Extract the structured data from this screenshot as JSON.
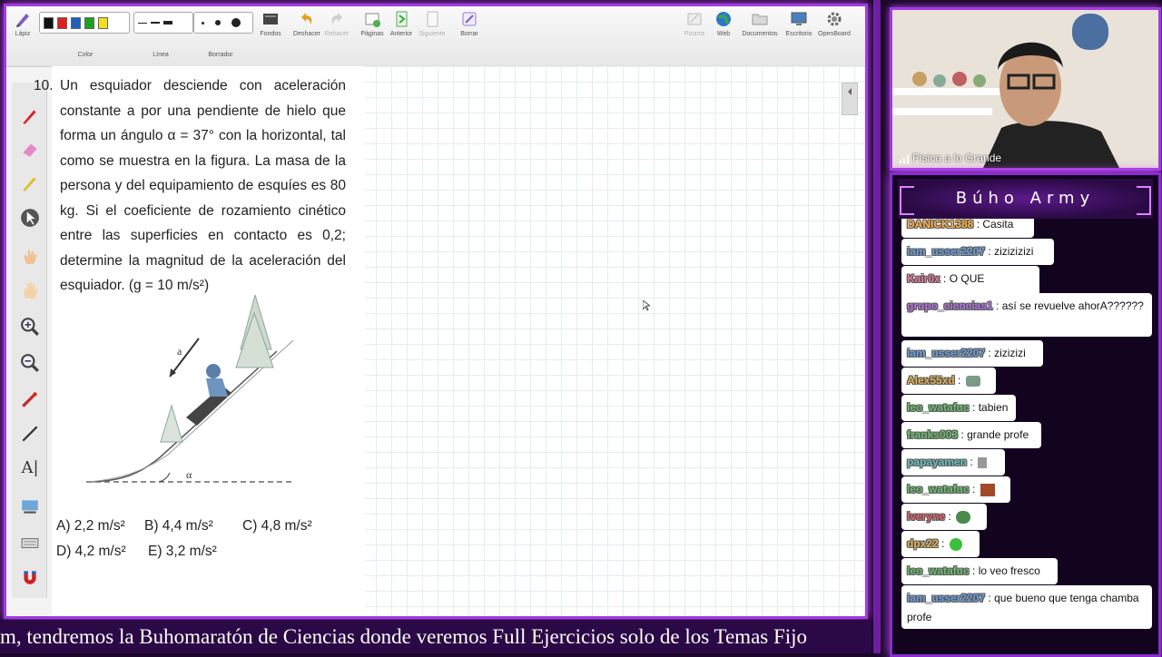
{
  "toolbar": {
    "left": [
      {
        "name": "pencil",
        "label": "Lápiz"
      },
      {
        "name": "color",
        "label": "Color"
      },
      {
        "name": "line",
        "label": "Línea"
      },
      {
        "name": "eraser",
        "label": "Borrador"
      },
      {
        "name": "backgrounds",
        "label": "Fondos"
      },
      {
        "name": "undo",
        "label": "Deshacer"
      },
      {
        "name": "redo",
        "label": "Rehacer"
      },
      {
        "name": "pages",
        "label": "Páginas"
      },
      {
        "name": "previous",
        "label": "Anterior"
      },
      {
        "name": "next",
        "label": "Siguiente"
      },
      {
        "name": "clear",
        "label": "Borrar"
      }
    ],
    "right": [
      {
        "name": "board",
        "label": "Pizarra"
      },
      {
        "name": "web",
        "label": "Web"
      },
      {
        "name": "documents",
        "label": "Documentos"
      },
      {
        "name": "desktop",
        "label": "Escritorio"
      },
      {
        "name": "openboard",
        "label": "OpenBoard"
      }
    ],
    "colors": [
      "#111111",
      "#e02020",
      "#2060c0",
      "#20a020",
      "#f0e020"
    ]
  },
  "problem": {
    "number": "10.",
    "text": "Un esquiador desciende con aceleración constante a por una pendiente de hielo que forma un ángulo α = 37° con la horizontal, tal como se muestra en la figura. La masa de la persona y del equipamiento de esquíes es 80 kg. Si el coeficiente de rozamiento cinético entre las superficies en contacto es 0,2; determine la magnitud de la aceleración del esquiador. (g = 10 m/s²)",
    "figure_label_a": "a",
    "figure_label_alpha": "α",
    "options": [
      {
        "label": "A) 2,2 m/s²"
      },
      {
        "label": "B) 4,4 m/s²"
      },
      {
        "label": "C) 4,8 m/s²"
      },
      {
        "label": "D) 4,2 m/s²"
      },
      {
        "label": "E) 3,2 m/s²"
      }
    ]
  },
  "webcam": {
    "caption": "Física a lo Grande"
  },
  "chat": {
    "title": "Búho Army",
    "messages": [
      {
        "user": "DANICK1388",
        "text": "Casita"
      },
      {
        "user": "iam_usser2207",
        "text": "zizizizizi"
      },
      {
        "user": "Kair0x",
        "text": "O QUE LOCAZOO"
      },
      {
        "user": "grupo_ciencias1",
        "text": "así se revuelve ahorA??????"
      },
      {
        "user": "iam_usser2207",
        "text": "zizizizi"
      },
      {
        "user": "Alex55xd",
        "text": ""
      },
      {
        "user": "leo_watafuc",
        "text": "tabien"
      },
      {
        "user": "franks003",
        "text": "grande profe"
      },
      {
        "user": "papayamen",
        "text": ""
      },
      {
        "user": "leo_watafuc",
        "text": ""
      },
      {
        "user": "lveryne",
        "text": ""
      },
      {
        "user": "dpx22",
        "text": ""
      },
      {
        "user": "leo_watafuc",
        "text": "lo veo fresco"
      },
      {
        "user": "iam_usser2207",
        "text": "que bueno que tenga chamba profe"
      }
    ]
  },
  "ticker": {
    "text": "m, tendremos la Buhomaratón de Ciencias donde veremos Full Ejercicios solo de los Temas Fijo"
  }
}
